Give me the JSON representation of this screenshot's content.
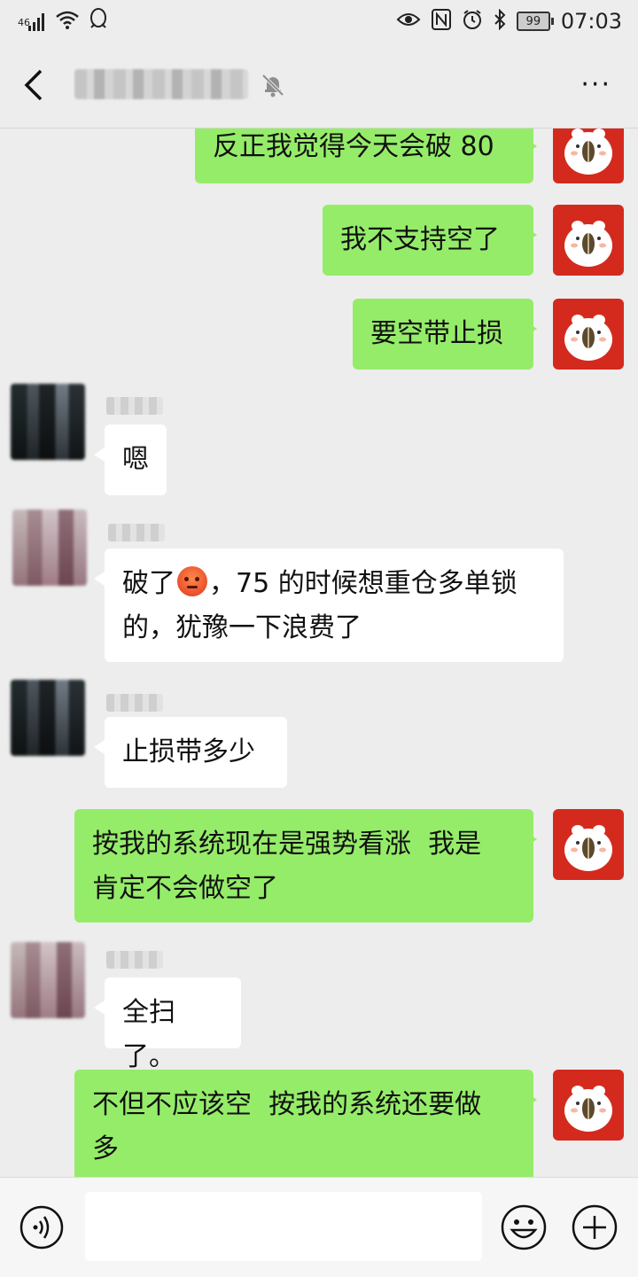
{
  "status_bar": {
    "network": "46",
    "battery": "99",
    "time": "07:03"
  },
  "header": {
    "back_icon": "chevron-left-icon",
    "mute_icon": "bell-off-icon",
    "more_label": "···"
  },
  "messages": [
    {
      "side": "out",
      "text": "反正我觉得今天会破 80"
    },
    {
      "side": "out",
      "text": "我不支持空了"
    },
    {
      "side": "out",
      "text": "要空带止损"
    },
    {
      "side": "in",
      "text": "嗯"
    },
    {
      "side": "in",
      "text_before": "破了",
      "emoji": "angry-face-emoji",
      "text_after_line1": "，75 的时候想重仓多单锁",
      "text_line2": "的，犹豫一下浪费了"
    },
    {
      "side": "in",
      "text": "止损带多少"
    },
    {
      "side": "out",
      "text_line1": "按我的系统现在是强势看涨  我是",
      "text_line2": "肯定不会做空了"
    },
    {
      "side": "in",
      "text": "全扫了。"
    },
    {
      "side": "out",
      "text_line1": "不但不应该空  按我的系统还要做",
      "text_line2": "多"
    }
  ],
  "input_bar": {
    "voice_icon": "voice-icon",
    "input_value": "",
    "emoji_icon": "smiley-icon",
    "plus_icon": "plus-icon"
  },
  "colors": {
    "outgoing_bubble": "#95ec69",
    "incoming_bubble": "#ffffff",
    "background": "#ededed",
    "my_avatar": "#d42a1e"
  }
}
